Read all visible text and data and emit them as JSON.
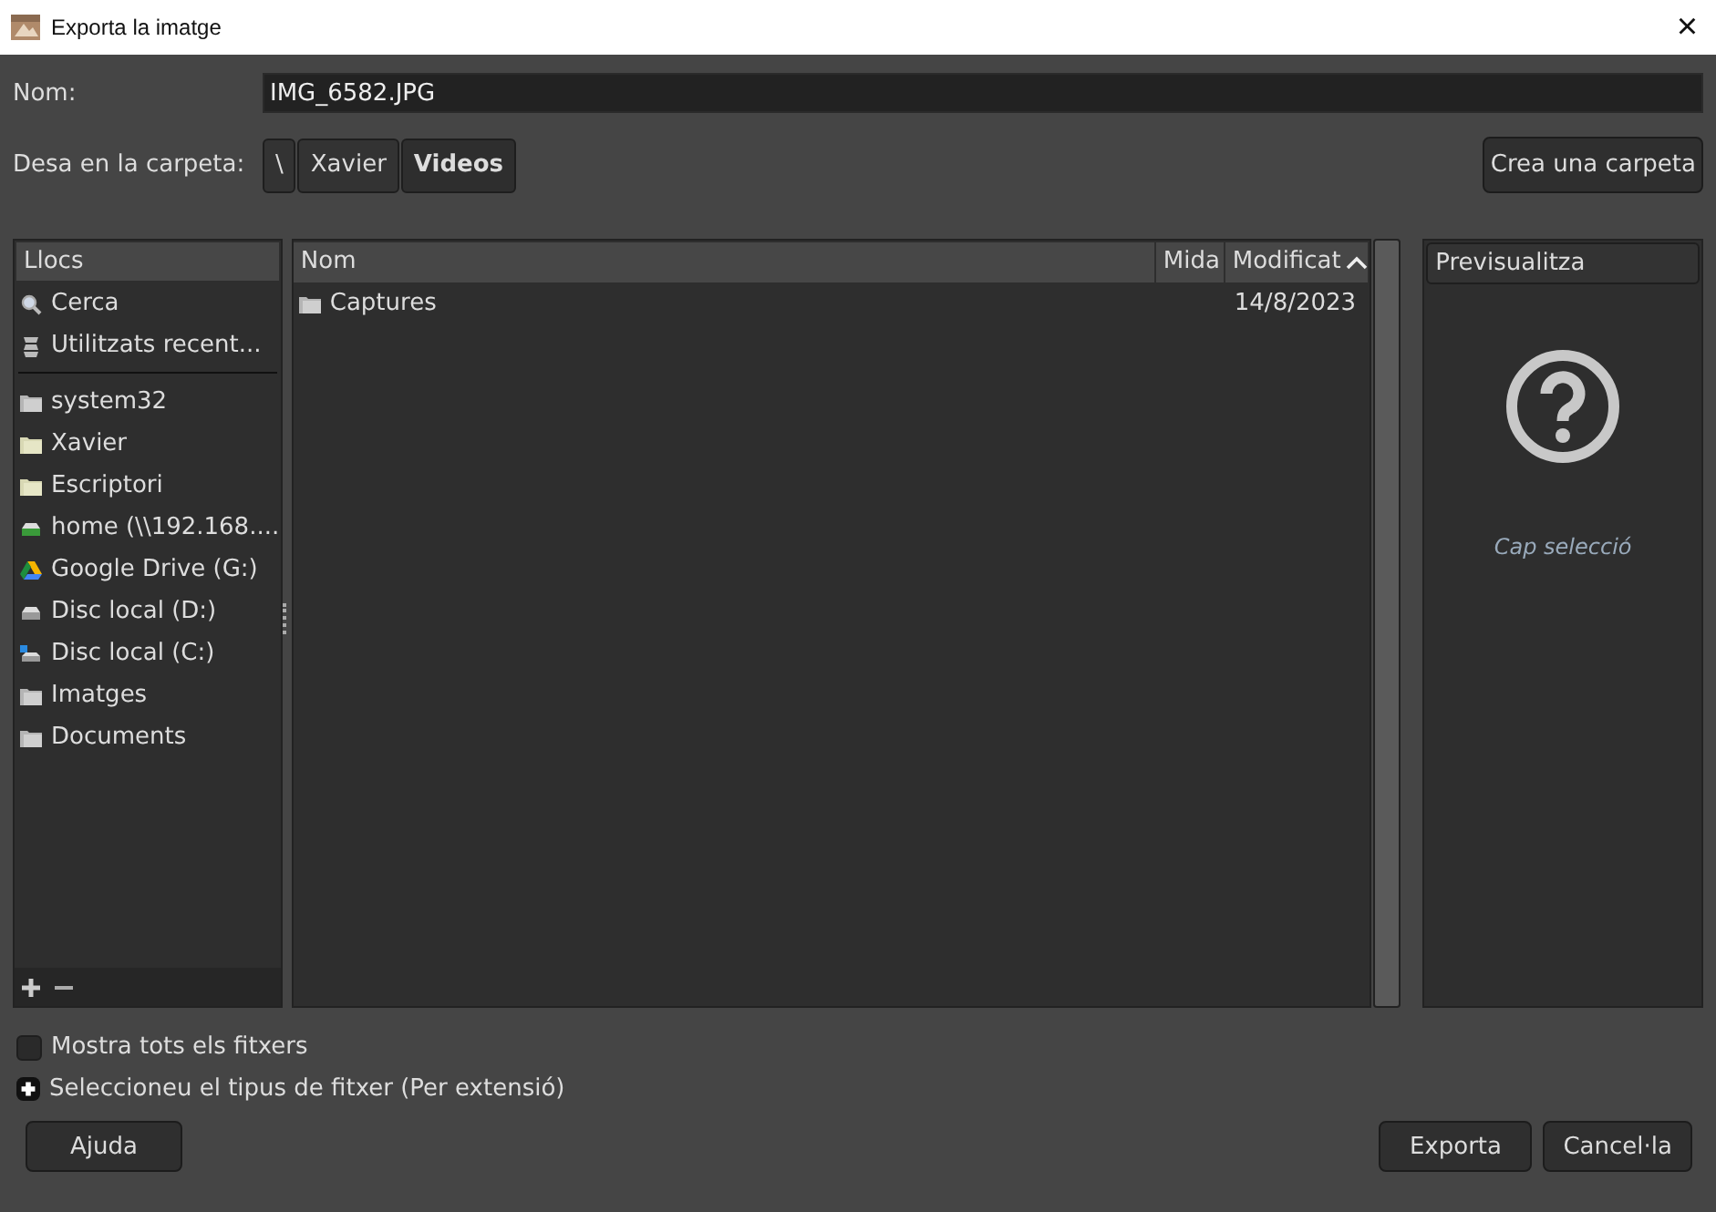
{
  "window": {
    "title": "Exporta la imatge",
    "close": "×"
  },
  "name_field": {
    "label": "Nom:",
    "value": "IMG_6582.JPG"
  },
  "folder": {
    "label": "Desa en la carpeta:",
    "path": [
      {
        "label": "\\",
        "selected": false
      },
      {
        "label": "Xavier",
        "selected": false
      },
      {
        "label": "Videos",
        "selected": true
      }
    ],
    "create_button": "Crea una carpeta"
  },
  "places": {
    "header": "Llocs",
    "items": [
      {
        "kind": "search",
        "label": "Cerca"
      },
      {
        "kind": "recent",
        "label": "Utilitzats recent..."
      },
      {
        "kind": "separator"
      },
      {
        "kind": "folder",
        "label": "system32"
      },
      {
        "kind": "home-folder",
        "label": "Xavier"
      },
      {
        "kind": "home-folder",
        "label": "Escriptori"
      },
      {
        "kind": "network",
        "label": "home (\\\\192.168...."
      },
      {
        "kind": "gdrive",
        "label": "Google Drive (G:)"
      },
      {
        "kind": "drive",
        "label": "Disc local (D:)"
      },
      {
        "kind": "system-drive",
        "label": "Disc local (C:)"
      },
      {
        "kind": "folder",
        "label": "Imatges"
      },
      {
        "kind": "folder",
        "label": "Documents"
      }
    ]
  },
  "files": {
    "columns": [
      {
        "label": "Nom",
        "sorted": false
      },
      {
        "label": "Mida",
        "sorted": false
      },
      {
        "label": "Modificat",
        "sorted": true
      }
    ],
    "rows": [
      {
        "name": "Captures",
        "size": "",
        "modified": "14/8/2023"
      }
    ]
  },
  "preview": {
    "header": "Previsualitza",
    "message": "Cap selecció"
  },
  "show_all": {
    "label": "Mostra tots els fitxers",
    "checked": false
  },
  "file_type": {
    "label": "Seleccioneu el tipus de fitxer (Per extensió)",
    "expanded": false
  },
  "buttons": {
    "help": "Ajuda",
    "export": "Exporta",
    "cancel": "Cancel·la"
  }
}
